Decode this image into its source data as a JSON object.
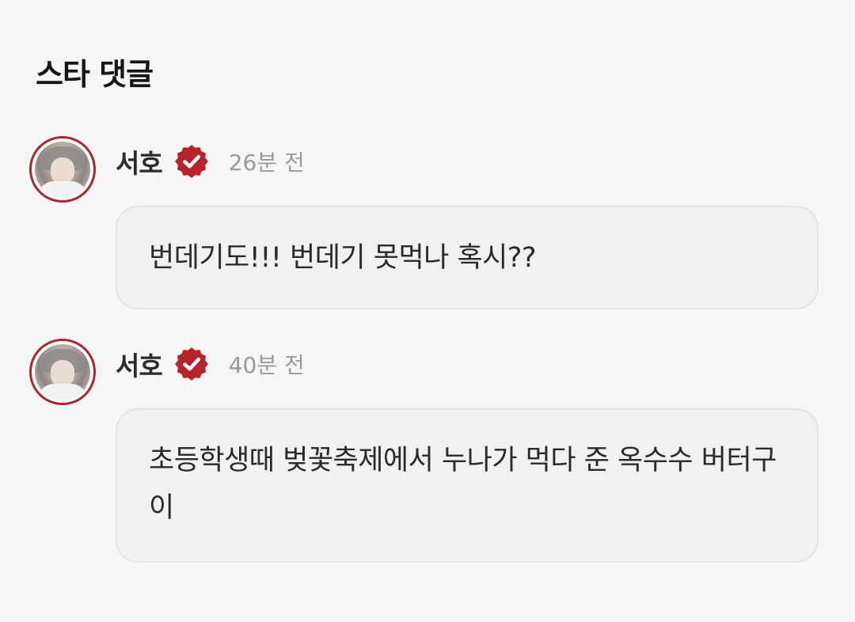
{
  "section": {
    "title": "스타 댓글"
  },
  "comments": [
    {
      "author": "서호",
      "verified_icon": "verified-badge-icon",
      "time": "26분 전",
      "text": "번데기도!!! 번데기 못먹나 혹시??"
    },
    {
      "author": "서호",
      "verified_icon": "verified-badge-icon",
      "time": "40분 전",
      "text": "초등학생때 벚꽃축제에서 누나가 먹다 준 옥수수 버터구이"
    }
  ],
  "colors": {
    "background": "#f6f6f6",
    "bubble": "#f1f1f1",
    "accent": "#b8222b",
    "avatar_ring": "#a8282e",
    "timestamp": "#9a9a9a"
  }
}
